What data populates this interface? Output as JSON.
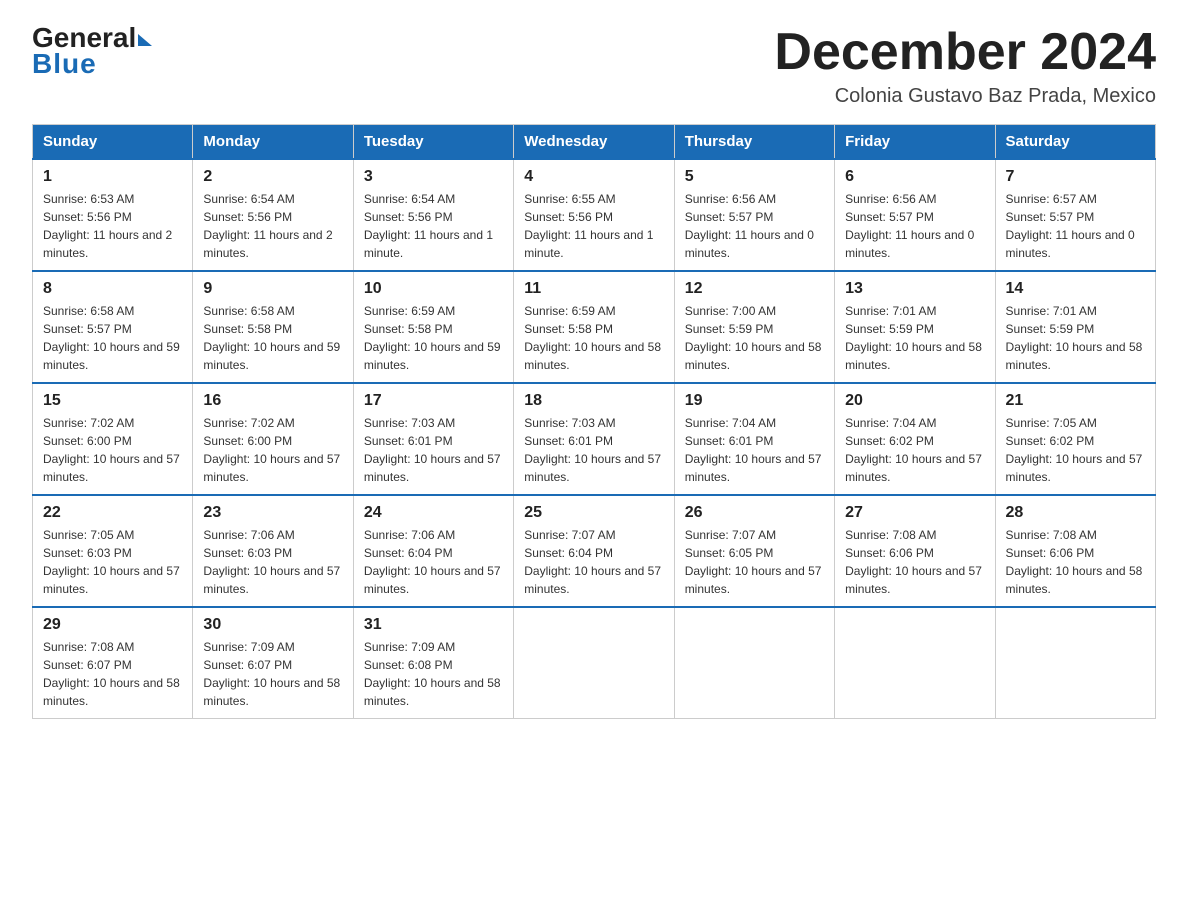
{
  "header": {
    "logo_general": "General",
    "logo_blue": "Blue",
    "month_title": "December 2024",
    "location": "Colonia Gustavo Baz Prada, Mexico"
  },
  "days_of_week": [
    "Sunday",
    "Monday",
    "Tuesday",
    "Wednesday",
    "Thursday",
    "Friday",
    "Saturday"
  ],
  "weeks": [
    [
      {
        "day": "1",
        "sunrise": "6:53 AM",
        "sunset": "5:56 PM",
        "daylight": "11 hours and 2 minutes."
      },
      {
        "day": "2",
        "sunrise": "6:54 AM",
        "sunset": "5:56 PM",
        "daylight": "11 hours and 2 minutes."
      },
      {
        "day": "3",
        "sunrise": "6:54 AM",
        "sunset": "5:56 PM",
        "daylight": "11 hours and 1 minute."
      },
      {
        "day": "4",
        "sunrise": "6:55 AM",
        "sunset": "5:56 PM",
        "daylight": "11 hours and 1 minute."
      },
      {
        "day": "5",
        "sunrise": "6:56 AM",
        "sunset": "5:57 PM",
        "daylight": "11 hours and 0 minutes."
      },
      {
        "day": "6",
        "sunrise": "6:56 AM",
        "sunset": "5:57 PM",
        "daylight": "11 hours and 0 minutes."
      },
      {
        "day": "7",
        "sunrise": "6:57 AM",
        "sunset": "5:57 PM",
        "daylight": "11 hours and 0 minutes."
      }
    ],
    [
      {
        "day": "8",
        "sunrise": "6:58 AM",
        "sunset": "5:57 PM",
        "daylight": "10 hours and 59 minutes."
      },
      {
        "day": "9",
        "sunrise": "6:58 AM",
        "sunset": "5:58 PM",
        "daylight": "10 hours and 59 minutes."
      },
      {
        "day": "10",
        "sunrise": "6:59 AM",
        "sunset": "5:58 PM",
        "daylight": "10 hours and 59 minutes."
      },
      {
        "day": "11",
        "sunrise": "6:59 AM",
        "sunset": "5:58 PM",
        "daylight": "10 hours and 58 minutes."
      },
      {
        "day": "12",
        "sunrise": "7:00 AM",
        "sunset": "5:59 PM",
        "daylight": "10 hours and 58 minutes."
      },
      {
        "day": "13",
        "sunrise": "7:01 AM",
        "sunset": "5:59 PM",
        "daylight": "10 hours and 58 minutes."
      },
      {
        "day": "14",
        "sunrise": "7:01 AM",
        "sunset": "5:59 PM",
        "daylight": "10 hours and 58 minutes."
      }
    ],
    [
      {
        "day": "15",
        "sunrise": "7:02 AM",
        "sunset": "6:00 PM",
        "daylight": "10 hours and 57 minutes."
      },
      {
        "day": "16",
        "sunrise": "7:02 AM",
        "sunset": "6:00 PM",
        "daylight": "10 hours and 57 minutes."
      },
      {
        "day": "17",
        "sunrise": "7:03 AM",
        "sunset": "6:01 PM",
        "daylight": "10 hours and 57 minutes."
      },
      {
        "day": "18",
        "sunrise": "7:03 AM",
        "sunset": "6:01 PM",
        "daylight": "10 hours and 57 minutes."
      },
      {
        "day": "19",
        "sunrise": "7:04 AM",
        "sunset": "6:01 PM",
        "daylight": "10 hours and 57 minutes."
      },
      {
        "day": "20",
        "sunrise": "7:04 AM",
        "sunset": "6:02 PM",
        "daylight": "10 hours and 57 minutes."
      },
      {
        "day": "21",
        "sunrise": "7:05 AM",
        "sunset": "6:02 PM",
        "daylight": "10 hours and 57 minutes."
      }
    ],
    [
      {
        "day": "22",
        "sunrise": "7:05 AM",
        "sunset": "6:03 PM",
        "daylight": "10 hours and 57 minutes."
      },
      {
        "day": "23",
        "sunrise": "7:06 AM",
        "sunset": "6:03 PM",
        "daylight": "10 hours and 57 minutes."
      },
      {
        "day": "24",
        "sunrise": "7:06 AM",
        "sunset": "6:04 PM",
        "daylight": "10 hours and 57 minutes."
      },
      {
        "day": "25",
        "sunrise": "7:07 AM",
        "sunset": "6:04 PM",
        "daylight": "10 hours and 57 minutes."
      },
      {
        "day": "26",
        "sunrise": "7:07 AM",
        "sunset": "6:05 PM",
        "daylight": "10 hours and 57 minutes."
      },
      {
        "day": "27",
        "sunrise": "7:08 AM",
        "sunset": "6:06 PM",
        "daylight": "10 hours and 57 minutes."
      },
      {
        "day": "28",
        "sunrise": "7:08 AM",
        "sunset": "6:06 PM",
        "daylight": "10 hours and 58 minutes."
      }
    ],
    [
      {
        "day": "29",
        "sunrise": "7:08 AM",
        "sunset": "6:07 PM",
        "daylight": "10 hours and 58 minutes."
      },
      {
        "day": "30",
        "sunrise": "7:09 AM",
        "sunset": "6:07 PM",
        "daylight": "10 hours and 58 minutes."
      },
      {
        "day": "31",
        "sunrise": "7:09 AM",
        "sunset": "6:08 PM",
        "daylight": "10 hours and 58 minutes."
      },
      null,
      null,
      null,
      null
    ]
  ]
}
